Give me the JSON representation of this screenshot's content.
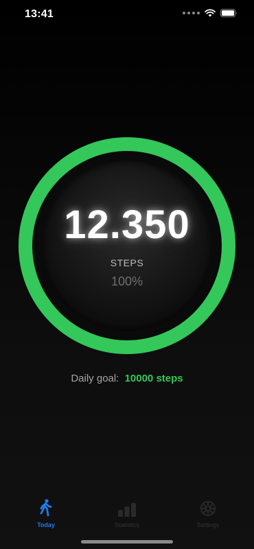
{
  "status_bar": {
    "time": "13:41"
  },
  "today": {
    "step_count": "12.350",
    "steps_label": "STEPS",
    "percent": "100%",
    "progress": 1.0,
    "goal_label": "Daily goal:",
    "goal_value": "10000 steps"
  },
  "tabs": [
    {
      "label": "Today",
      "icon": "walk-icon",
      "active": true
    },
    {
      "label": "Statistics",
      "icon": "bar-chart-icon",
      "active": false
    },
    {
      "label": "Settings",
      "icon": "gear-icon",
      "active": false
    }
  ],
  "colors": {
    "accent": "#34c759",
    "tab_active": "#1e7bf0",
    "background": "#000000"
  }
}
